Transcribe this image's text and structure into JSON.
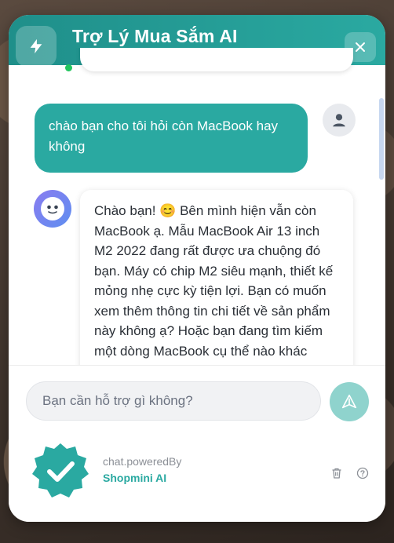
{
  "header": {
    "title": "Trợ Lý Mua Sắm AI"
  },
  "messages": [
    {
      "role": "user",
      "text": "chào bạn cho tôi hỏi còn MacBook hay không"
    },
    {
      "role": "assistant",
      "text": "Chào bạn! 😊 Bên mình hiện vẫn còn MacBook ạ. Mẫu MacBook Air 13 inch M2 2022 đang rất được ưa chuộng đó bạn. Máy có chip M2 siêu mạnh, thiết kế mỏng nhẹ cực kỳ tiện lợi. Bạn có muốn xem thêm thông tin chi tiết về sản phẩm này không ạ? Hoặc bạn đang tìm kiếm một dòng MacBook cụ thể nào khác không, mình sẽ tìm giúp"
    }
  ],
  "composer": {
    "placeholder": "Bạn cần hỗ trợ gì không?",
    "value": ""
  },
  "footer": {
    "powered_by": "chat.poweredBy",
    "brand": "Shopmini AI"
  },
  "icons": {
    "logo": "lightning-icon",
    "close": "close-icon",
    "user_avatar": "user-icon",
    "bot_avatar": "bot-face-icon",
    "send": "send-icon",
    "badge": "verified-check-icon",
    "delete": "trash-icon",
    "help": "help-icon"
  },
  "colors": {
    "accent": "#2aa9a1",
    "header": "#1f8f8a",
    "online": "#22c55e",
    "send_button": "#8fd3cd"
  }
}
